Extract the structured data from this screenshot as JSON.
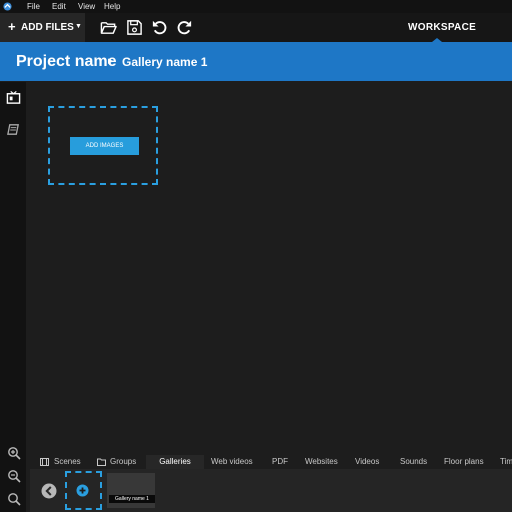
{
  "menu": {
    "items": [
      "File",
      "Edit",
      "View",
      "Help"
    ]
  },
  "toolbar": {
    "add_files_label": "ADD FILES",
    "icons": [
      "folder-open-icon",
      "save-icon",
      "undo-icon",
      "redo-icon"
    ],
    "workspace_label": "WORKSPACE"
  },
  "header": {
    "project_name": "Project name",
    "gallery_name": "Gallery name 1"
  },
  "canvas": {
    "add_images_label": "ADD IMAGES"
  },
  "tabs": [
    "Scenes",
    "Groups",
    "Galleries",
    "Web videos",
    "PDF",
    "Websites",
    "Videos",
    "Sounds",
    "Floor plans",
    "Tim"
  ],
  "active_tab": "Galleries",
  "gallery_strip": {
    "items": [
      {
        "label": "Gallery name 1"
      }
    ]
  },
  "colors": {
    "accent": "#1e77c6",
    "button": "#279ddc",
    "dashed": "#2a9fe0",
    "background": "#1d1d1d"
  }
}
